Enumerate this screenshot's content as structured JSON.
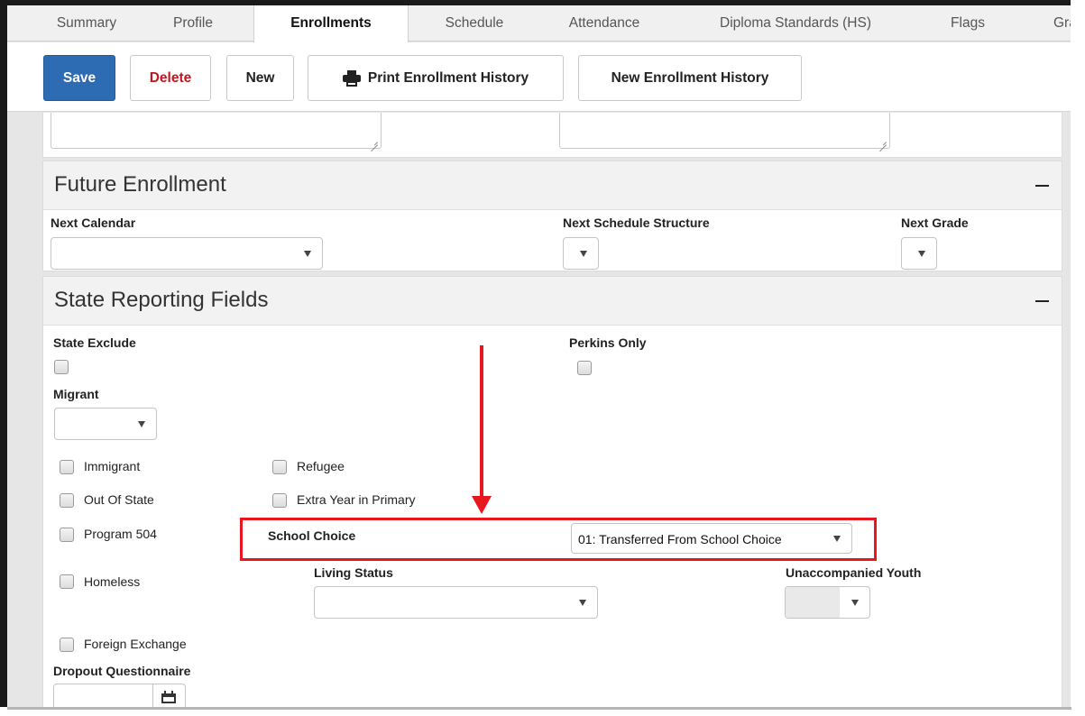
{
  "tabs": [
    {
      "label": "Summary"
    },
    {
      "label": "Profile"
    },
    {
      "label": "Enrollments"
    },
    {
      "label": "Schedule"
    },
    {
      "label": "Attendance"
    },
    {
      "label": "Diploma Standards (HS)"
    },
    {
      "label": "Flags"
    },
    {
      "label": "Grades"
    }
  ],
  "active_tab": "Enrollments",
  "toolbar": {
    "save_label": "Save",
    "delete_label": "Delete",
    "new_label": "New",
    "print_label": "Print Enrollment History",
    "new_history_label": "New Enrollment History"
  },
  "future_enrollment": {
    "title": "Future Enrollment",
    "next_calendar_label": "Next Calendar",
    "next_calendar_value": "",
    "next_schedule_structure_label": "Next Schedule Structure",
    "next_schedule_structure_value": "",
    "next_grade_label": "Next Grade",
    "next_grade_value": ""
  },
  "state_reporting": {
    "title": "State Reporting Fields",
    "state_exclude_label": "State Exclude",
    "perkins_only_label": "Perkins Only",
    "migrant_label": "Migrant",
    "migrant_value": "",
    "immigrant_label": "Immigrant",
    "refugee_label": "Refugee",
    "out_of_state_label": "Out Of State",
    "extra_year_label": "Extra Year in Primary",
    "program_504_label": "Program 504",
    "school_choice_label": "School Choice",
    "school_choice_value": "01: Transferred From School Choice",
    "homeless_label": "Homeless",
    "living_status_label": "Living Status",
    "living_status_value": "",
    "unaccompanied_youth_label": "Unaccompanied Youth",
    "unaccompanied_youth_value": "",
    "foreign_exchange_label": "Foreign Exchange",
    "dropout_questionnaire_label": "Dropout Questionnaire",
    "dropout_questionnaire_value": ""
  },
  "colors": {
    "save_button": "#2d6bb3",
    "delete_text": "#c0171f",
    "annotation_red": "#e8161f"
  }
}
